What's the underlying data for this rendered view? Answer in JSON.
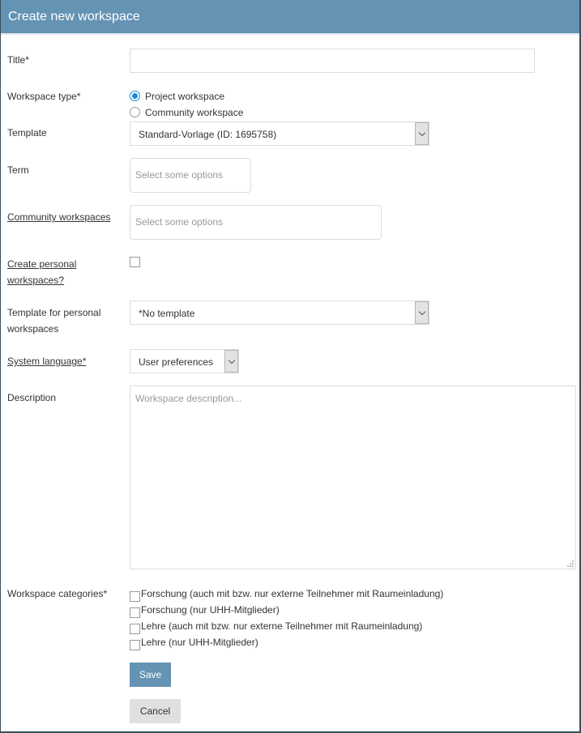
{
  "header": {
    "title": "Create new workspace"
  },
  "colors": {
    "header_bg": "#6593b4",
    "accent_radio": "#1e8ad6",
    "save_bg": "#6593b4",
    "cancel_bg": "#e0e0e0"
  },
  "form": {
    "title": {
      "label": "Title*",
      "value": ""
    },
    "workspace_type": {
      "label": "Workspace type*",
      "options": [
        {
          "label": "Project workspace",
          "checked": true
        },
        {
          "label": "Community workspace",
          "checked": false
        }
      ]
    },
    "template": {
      "label": "Template",
      "value": "Standard-Vorlage (ID: 1695758)",
      "icon": "chevron-down-icon"
    },
    "term": {
      "label": "Term",
      "placeholder": "Select some options"
    },
    "community_workspaces": {
      "label": "Community workspaces",
      "placeholder": "Select some options"
    },
    "create_personal": {
      "label_line1": "Create personal",
      "label_line2": "workspaces?",
      "checked": false
    },
    "personal_template": {
      "label_line1": "Template for personal",
      "label_line2": "workspaces",
      "value": "*No template"
    },
    "system_language": {
      "label": "System language*",
      "value": "User preferences"
    },
    "description": {
      "label": "Description",
      "placeholder": "Workspace description..."
    },
    "categories": {
      "label": "Workspace categories*",
      "items": [
        {
          "label": "Forschung (auch mit bzw. nur externe Teilnehmer mit Raumeinladung)",
          "checked": false
        },
        {
          "label": "Forschung (nur UHH-Mitglieder)",
          "checked": false
        },
        {
          "label": "Lehre (auch mit bzw. nur externe Teilnehmer mit Raumeinladung)",
          "checked": false
        },
        {
          "label": "Lehre (nur UHH-Mitglieder)",
          "checked": false
        }
      ]
    }
  },
  "actions": {
    "save_label": "Save",
    "cancel_label": "Cancel"
  }
}
